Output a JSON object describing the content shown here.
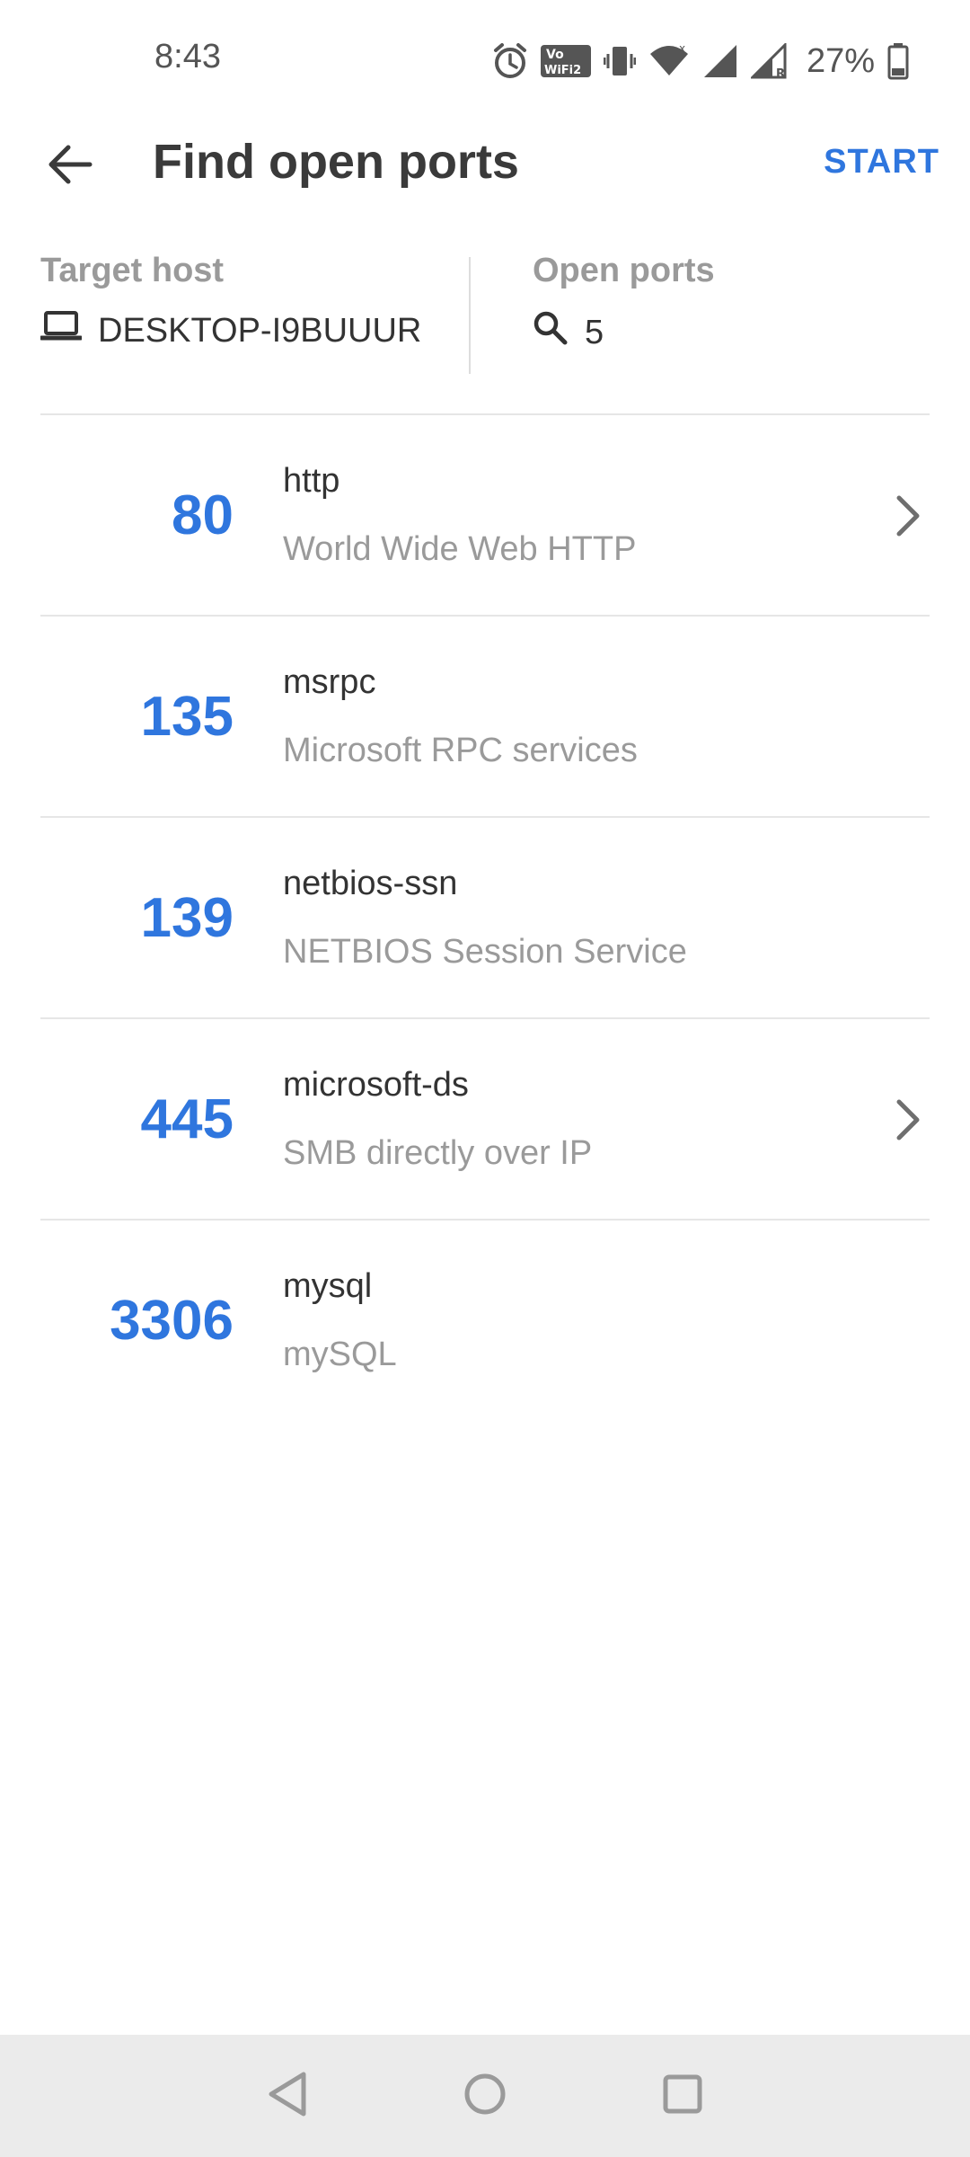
{
  "status_bar": {
    "time": "8:43",
    "battery_percent": "27%",
    "icons": [
      "alarm-icon",
      "vowifi-icon",
      "vibrate-icon",
      "wifi-icon",
      "signal-icon",
      "signal-roaming-icon",
      "battery-icon"
    ]
  },
  "app_bar": {
    "title": "Find open ports",
    "start_label": "START"
  },
  "summary": {
    "target_host_label": "Target host",
    "target_host_value": "DESKTOP-I9BUUUR",
    "open_ports_label": "Open ports",
    "open_ports_value": "5"
  },
  "ports": [
    {
      "number": "80",
      "service": "http",
      "description": "World Wide Web HTTP",
      "has_details": true
    },
    {
      "number": "135",
      "service": "msrpc",
      "description": "Microsoft RPC services",
      "has_details": false
    },
    {
      "number": "139",
      "service": "netbios-ssn",
      "description": "NETBIOS Session Service",
      "has_details": false
    },
    {
      "number": "445",
      "service": "microsoft-ds",
      "description": "SMB directly over IP",
      "has_details": true
    },
    {
      "number": "3306",
      "service": "mysql",
      "description": "mySQL",
      "has_details": false
    }
  ],
  "colors": {
    "accent": "#2f76de",
    "secondary_text": "#9a9a9a",
    "nav_background": "#ebebeb"
  }
}
